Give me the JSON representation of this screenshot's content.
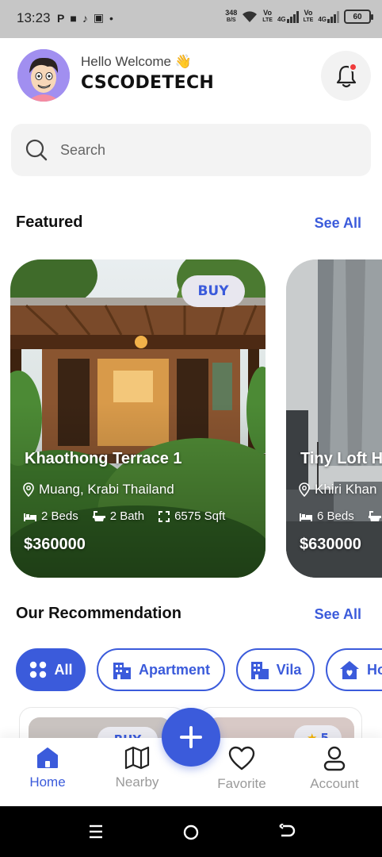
{
  "status_bar": {
    "time": "13:23",
    "left_icons": [
      "P",
      "■",
      "♪",
      "▣",
      "•"
    ],
    "net_speed_value": "348",
    "net_speed_unit": "B/S",
    "sim1_label_top": "Vo",
    "sim1_label_bottom": "LTE",
    "sim1_type": "4G",
    "sim2_label_top": "Vo",
    "sim2_label_bottom": "LTE",
    "sim2_type": "4G",
    "battery": "60"
  },
  "header": {
    "greeting": "Hello Welcome 👋",
    "username": "CSCODETECH"
  },
  "search": {
    "placeholder": "Search"
  },
  "featured": {
    "title": "Featured",
    "see_all": "See All",
    "cards": [
      {
        "badge": "BUY",
        "title": "Khaothong Terrace 1",
        "location": "Muang, Krabi Thailand",
        "beds": "2 Beds",
        "bath": "2 Bath",
        "area": "6575 Sqft",
        "price": "$360000"
      },
      {
        "title": "Tiny Loft H",
        "location": "Khiri Khan",
        "beds": "6 Beds",
        "price": "$630000"
      }
    ]
  },
  "recommendation": {
    "title": "Our Recommendation",
    "see_all": "See All",
    "chips": [
      {
        "label": "All",
        "active": true
      },
      {
        "label": "Apartment",
        "active": false
      },
      {
        "label": "Vila",
        "active": false
      },
      {
        "label": "Ho",
        "active": false
      }
    ],
    "preview_badge_1": "BUY",
    "preview_badge_2": "5"
  },
  "bottom_nav": {
    "items": [
      {
        "label": "Home",
        "active": true
      },
      {
        "label": "Nearby",
        "active": false
      },
      {
        "label": "Favorite",
        "active": false
      },
      {
        "label": "Account",
        "active": false
      }
    ]
  },
  "colors": {
    "accent": "#3b5bdb",
    "notification_dot": "#f03b3b",
    "avatar_bg": "#a18ff0"
  }
}
